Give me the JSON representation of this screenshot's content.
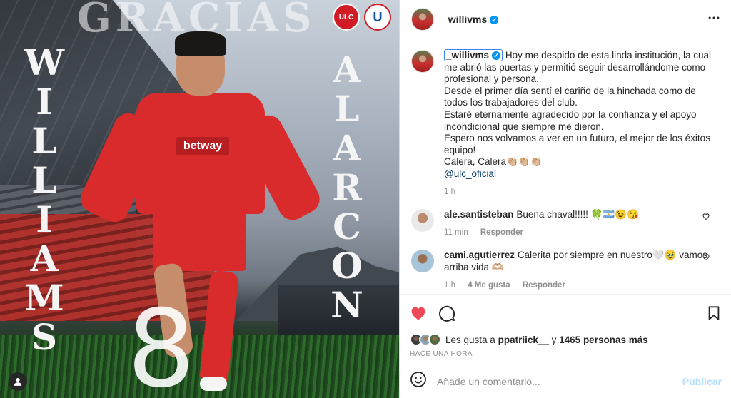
{
  "image": {
    "title_word": "GRACIAS",
    "first_name_letters": [
      "W",
      "I",
      "L",
      "L",
      "I",
      "A",
      "M",
      "S"
    ],
    "last_name_letters": [
      "A",
      "L",
      "A",
      "R",
      "C",
      "O",
      "N"
    ],
    "number": "8",
    "sponsor": "betway",
    "badge_left": "ULC",
    "badge_right": "U"
  },
  "header": {
    "username": "_willivms",
    "verified_mark": "✓",
    "more_icon": "more-horizontal-icon"
  },
  "caption": {
    "username": "_willivms",
    "text": "Hoy me despido de esta linda institución, la cual me abrió las puertas y permitió seguir desarrollándome como profesional y persona.\nDesde el primer día sentí el cariño de la hinchada como de todos los trabajadores del club.\nEstaré eternamente agradecido por la confianza y el apoyo incondicional que siempre me dieron.\nEspero nos volvamos a ver en un futuro, el mejor de los éxitos equipo!\nCalera, Calera👏🏼👏🏼👏🏼",
    "mention": "@ulc_oficial",
    "time": "1 h"
  },
  "comments": [
    {
      "username": "ale.santisteban",
      "text": "Buena chaval!!!!! 🍀🇦🇷😉😘",
      "time": "11 min",
      "likes": "",
      "reply": "Responder"
    },
    {
      "username": "cami.agutierrez",
      "text": "Calerita por siempre en nuestro🤍🥹 vamos arriba vida 🫶🏼",
      "time": "1 h",
      "likes": "4 Me gusta",
      "reply": "Responder"
    }
  ],
  "likes": {
    "prefix": "Les gusta a",
    "first_user": "ppatriick__",
    "joiner": "y",
    "others": "1465 personas más"
  },
  "posted_ago": "HACE UNA HORA",
  "add_comment": {
    "placeholder": "Añade un comentario...",
    "post_label": "Publicar"
  },
  "colors": {
    "like_red": "#ed4956",
    "verified_blue": "#0095f6",
    "publish_disabled": "#b2dffc"
  }
}
